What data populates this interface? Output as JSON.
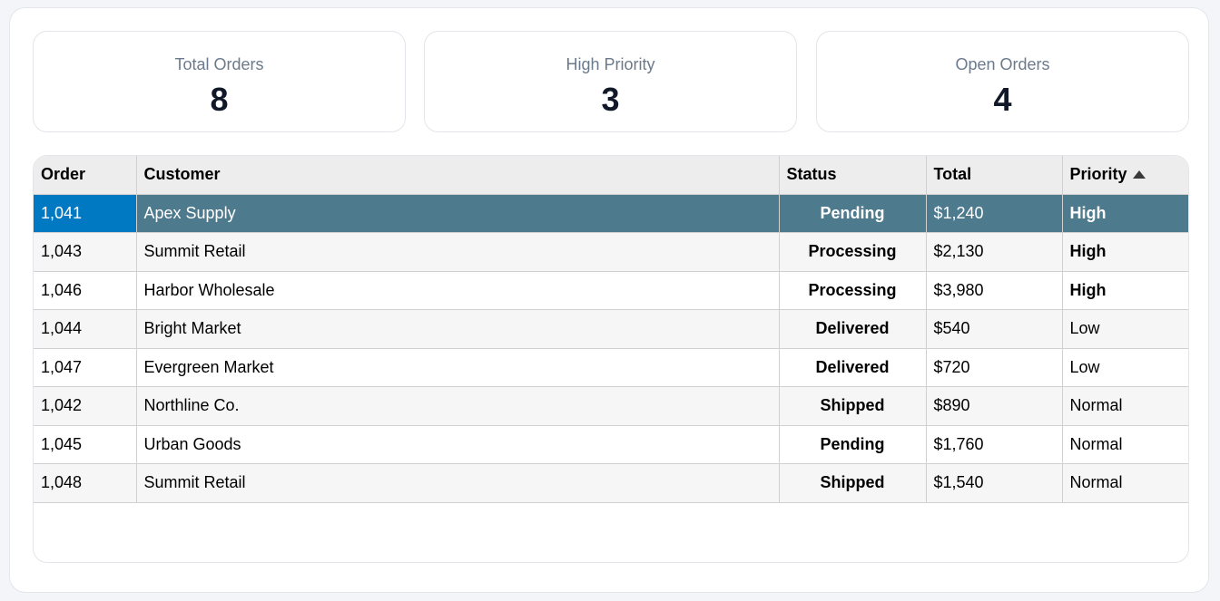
{
  "kpis": [
    {
      "label": "Total Orders",
      "value": "8"
    },
    {
      "label": "High Priority",
      "value": "3"
    },
    {
      "label": "Open Orders",
      "value": "4"
    }
  ],
  "table": {
    "columns": [
      "Order",
      "Customer",
      "Status",
      "Total",
      "Priority"
    ],
    "sort": {
      "column": "Priority",
      "direction": "ascending"
    },
    "selected_row": 0,
    "rows": [
      {
        "order": "1,041",
        "customer": "Apex Supply",
        "status": "Pending",
        "total": "$1,240",
        "priority": "High"
      },
      {
        "order": "1,043",
        "customer": "Summit Retail",
        "status": "Processing",
        "total": "$2,130",
        "priority": "High"
      },
      {
        "order": "1,046",
        "customer": "Harbor Wholesale",
        "status": "Processing",
        "total": "$3,980",
        "priority": "High"
      },
      {
        "order": "1,044",
        "customer": "Bright Market",
        "status": "Delivered",
        "total": "$540",
        "priority": "Low"
      },
      {
        "order": "1,047",
        "customer": "Evergreen Market",
        "status": "Delivered",
        "total": "$720",
        "priority": "Low"
      },
      {
        "order": "1,042",
        "customer": "Northline Co.",
        "status": "Shipped",
        "total": "$890",
        "priority": "Normal"
      },
      {
        "order": "1,045",
        "customer": "Urban Goods",
        "status": "Pending",
        "total": "$1,760",
        "priority": "Normal"
      },
      {
        "order": "1,048",
        "customer": "Summit Retail",
        "status": "Shipped",
        "total": "$1,540",
        "priority": "Normal"
      }
    ]
  },
  "colors": {
    "selected_row": "#4e7a8e",
    "selected_cell": "#0078c2",
    "header_bg": "#ededed",
    "kpi_label": "#6b7a8c"
  }
}
